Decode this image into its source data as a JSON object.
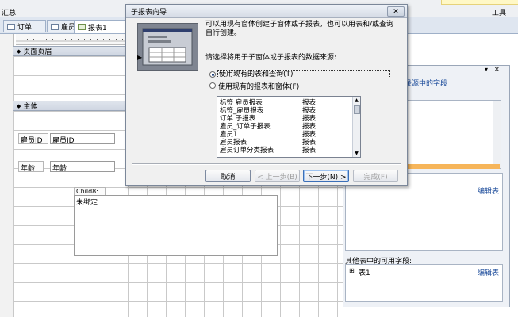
{
  "topbar": {
    "left_text": "汇总",
    "right_text": "工具"
  },
  "tabs": [
    {
      "label": "订单"
    },
    {
      "label": "雇员"
    },
    {
      "label": "报表1"
    }
  ],
  "designer": {
    "page_header": "页面页眉",
    "main_section": "主体",
    "fields": [
      {
        "label": "雇员ID",
        "value": "雇员ID"
      },
      {
        "label": "年龄",
        "value": "年龄"
      }
    ],
    "child_label": "Child8:",
    "unbound": "未绑定"
  },
  "field_list": {
    "title_fragment": "录源中的字段",
    "other_tables_label": "其他表中的可用字段:",
    "edit_table_1": "编辑表",
    "edit_table_2": "编辑表",
    "tree_item": "表1",
    "tree_expander": "⊞",
    "partial_letter": "b"
  },
  "dialog": {
    "title": "子报表向导",
    "close": "✕",
    "intro": "可以用现有窗体创建子窗体或子报表，也可以用表和/或查询自行创建。",
    "prompt": "请选择将用于子窗体或子报表的数据来源:",
    "option_tables": "使用现有的表和查询(T)",
    "option_forms": "使用现有的报表和窗体(F)",
    "list_items": [
      {
        "name": "标签  雇员报表",
        "type": "报表"
      },
      {
        "name": "标签_雇员报表",
        "type": "报表"
      },
      {
        "name": "订单 子报表",
        "type": "报表"
      },
      {
        "name": "雇员_订单子报表",
        "type": "报表"
      },
      {
        "name": "雇员1",
        "type": "报表"
      },
      {
        "name": "雇员报表",
        "type": "报表"
      },
      {
        "name": "雇员订单分类报表",
        "type": "报表"
      }
    ],
    "buttons": {
      "cancel": "取消",
      "back": "< 上一步(B)",
      "next": "下一步(N) >",
      "finish": "完成(F)"
    }
  }
}
